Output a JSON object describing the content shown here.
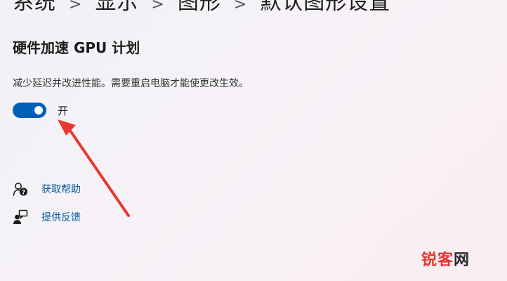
{
  "breadcrumb": {
    "items": [
      "系统",
      "显示",
      "图形",
      "默认图形设置"
    ],
    "separator": ">"
  },
  "gpu_scheduling": {
    "title": "硬件加速 GPU 计划",
    "description": "减少延迟并改进性能。需要重启电脑才能使更改生效。",
    "toggle_state_label": "开",
    "toggle_on": true
  },
  "links": {
    "help": "获取帮助",
    "feedback": "提供反馈"
  },
  "watermark": {
    "part1": "锐客",
    "part2": "网"
  },
  "colors": {
    "accent": "#005fb8",
    "link": "#005a9e",
    "annotation_arrow": "#e8382f"
  },
  "icons": {
    "help": "help-person-icon",
    "feedback": "feedback-person-icon"
  }
}
